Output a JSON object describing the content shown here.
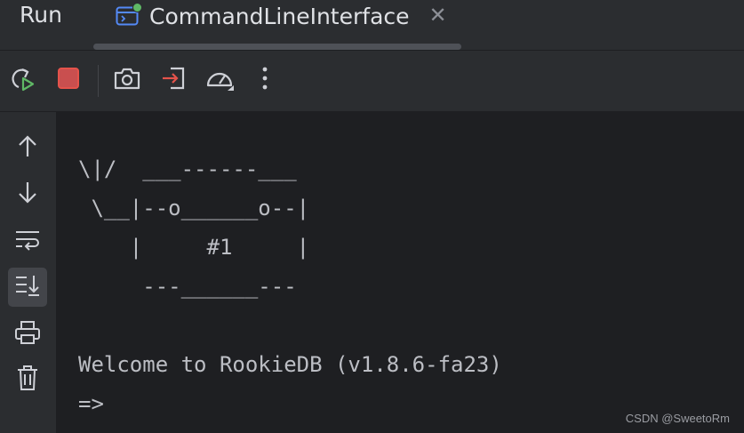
{
  "header": {
    "run_label": "Run",
    "tab": {
      "label": "CommandLineInterface",
      "icon": "console-icon",
      "close": "✕",
      "status_color": "#5fb865"
    }
  },
  "toolbar": {
    "buttons": [
      "rerun-icon",
      "stop-icon",
      "screenshot-icon",
      "exit-icon",
      "profiler-icon",
      "more-vertical-icon"
    ],
    "stop_color": "#e5534b",
    "rerun_color": "#5fb865",
    "exit_color": "#e5534b"
  },
  "sidebar": {
    "buttons": [
      "arrow-up-icon",
      "arrow-down-icon",
      "soft-wrap-icon",
      "scroll-to-end-icon",
      "print-icon",
      "trash-icon"
    ],
    "active": "scroll-to-end-icon"
  },
  "console": {
    "lines": [
      "\\|/  ___------___",
      " \\__|--o______o--|",
      "    |     #1     |",
      "     ---______---",
      "Welcome to RookieDB (v1.8.6-fa23)",
      "=>"
    ]
  },
  "watermark": "CSDN @SweetoRm"
}
